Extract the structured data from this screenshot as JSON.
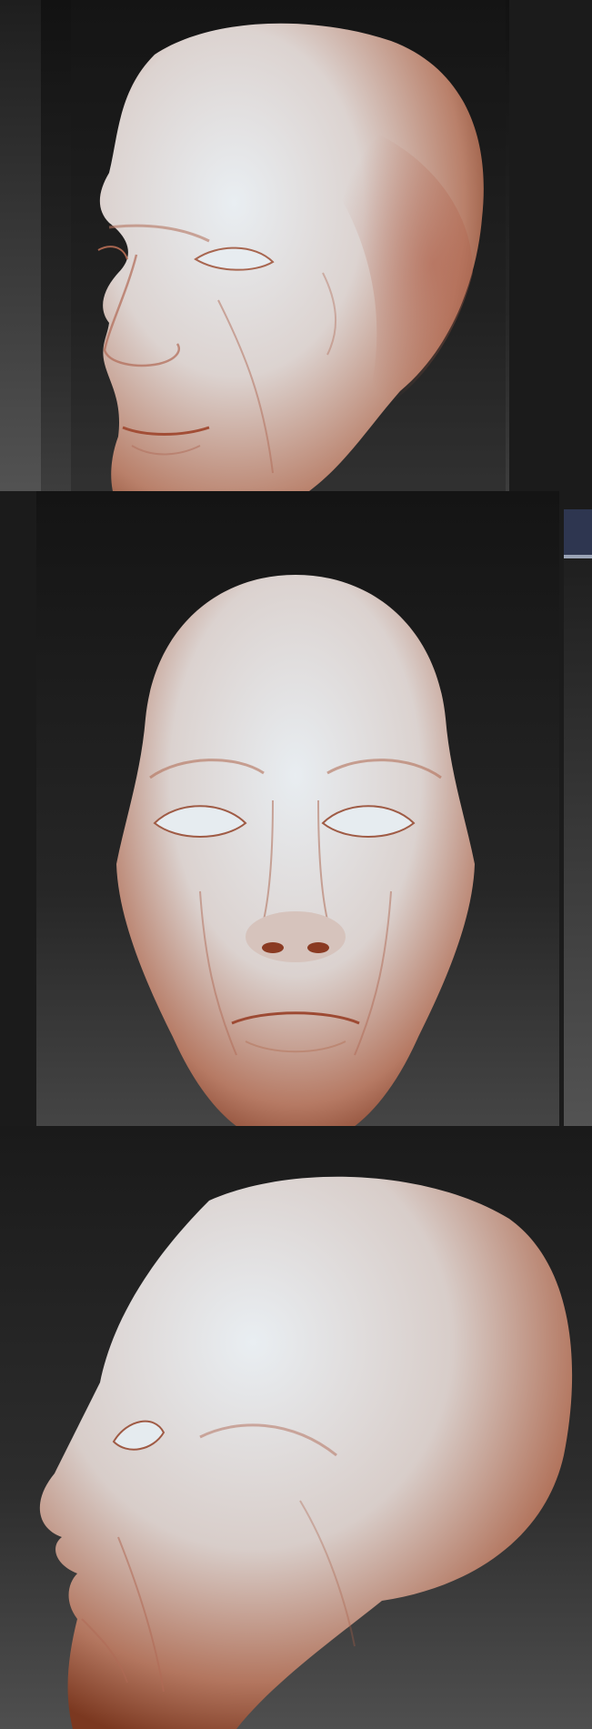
{
  "views": [
    {
      "id": "three-quarter"
    },
    {
      "id": "front"
    },
    {
      "id": "profile"
    }
  ],
  "colors": {
    "skin_light": "#dfe6ec",
    "skin_mid": "#c9a89c",
    "skin_dark": "#9a4a2c",
    "bg_dark": "#151515",
    "bg_mid": "#3a3a3a",
    "accent_blue": "#3a4560"
  }
}
